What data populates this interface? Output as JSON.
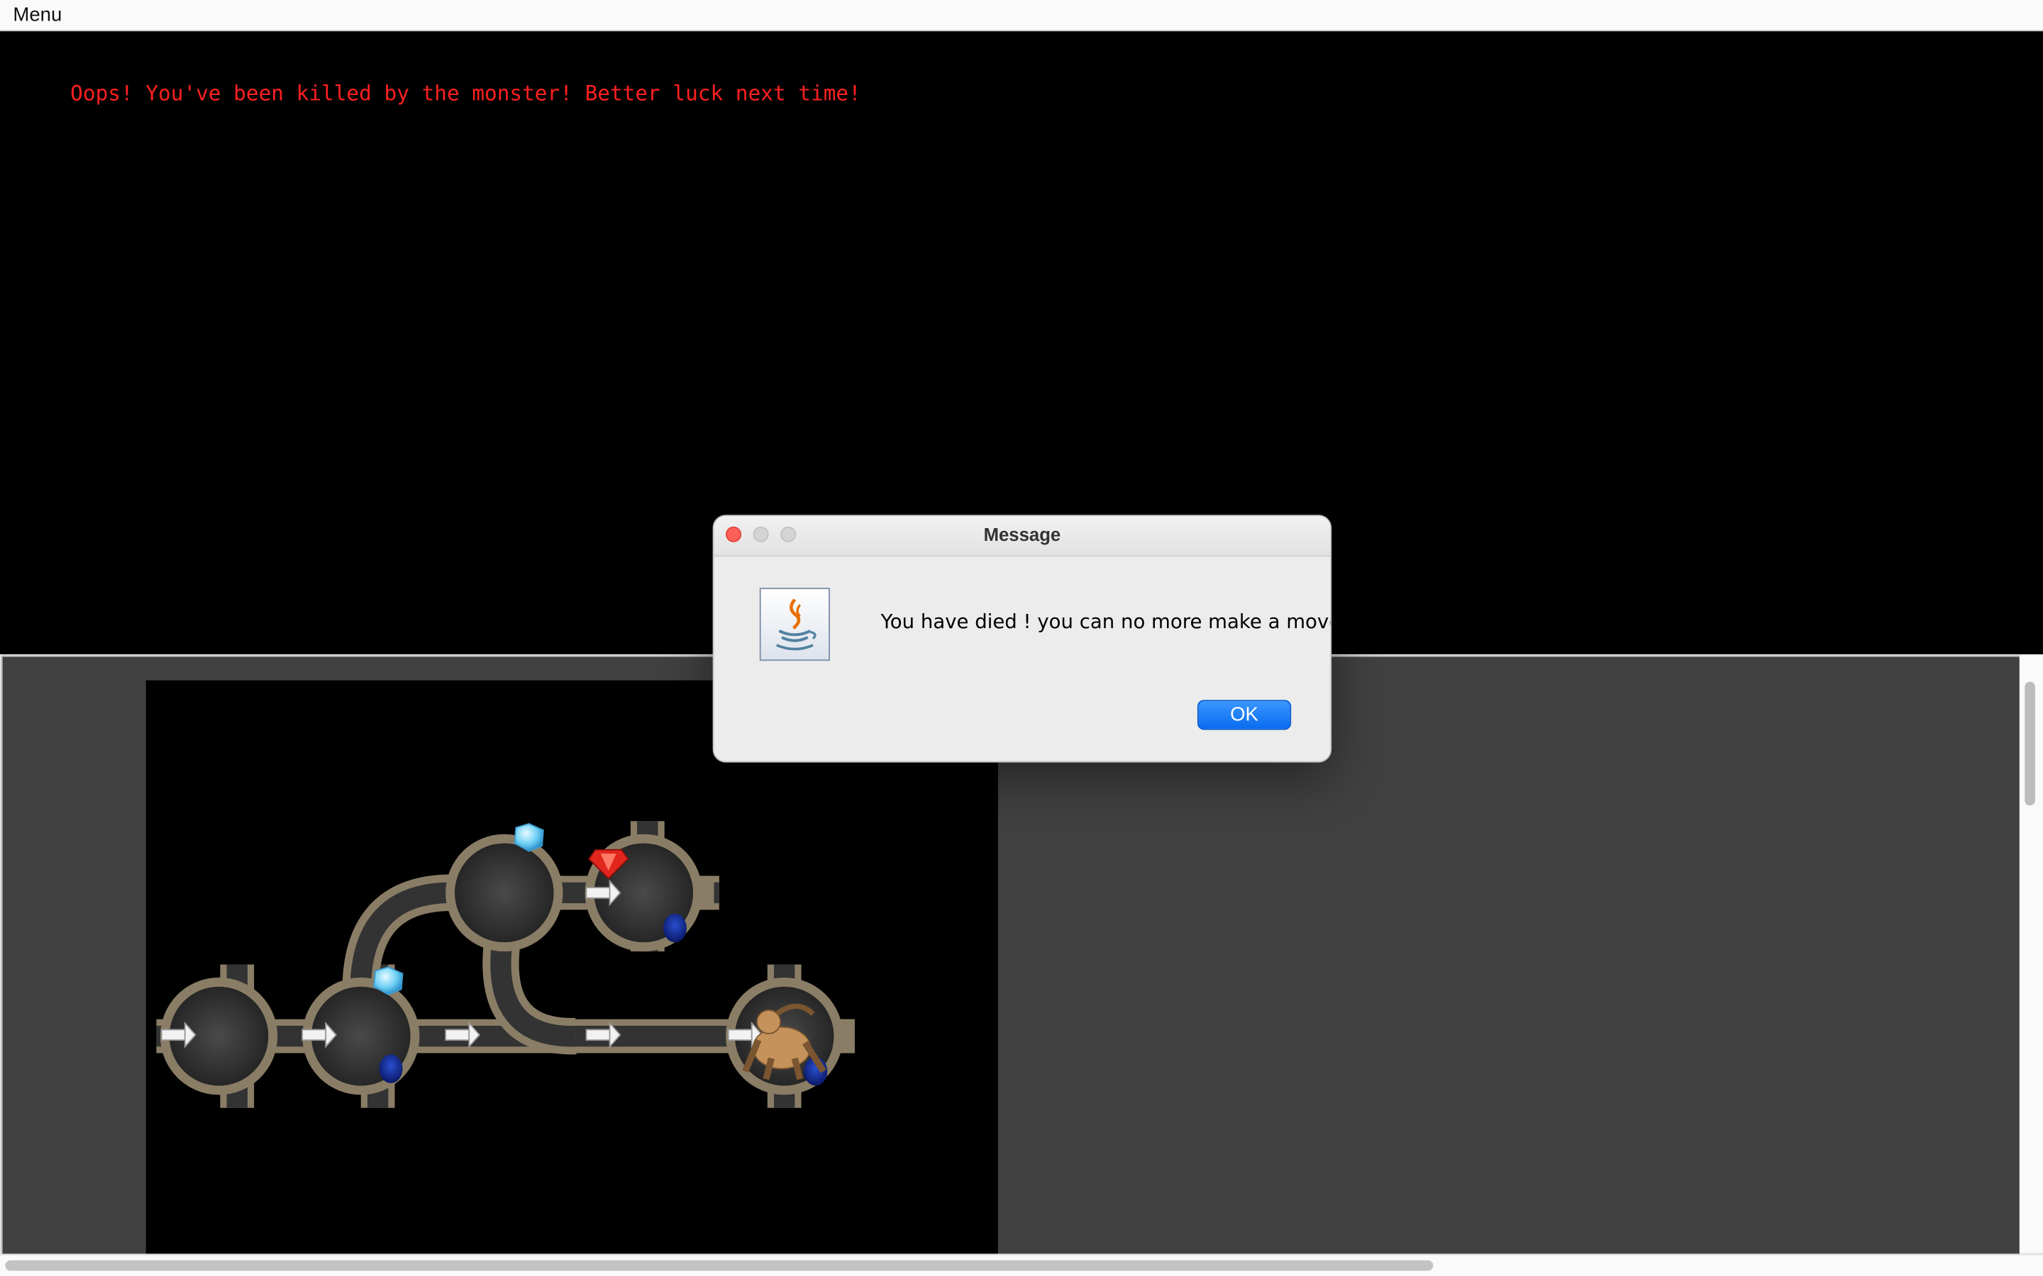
{
  "menubar": {
    "menu_label": "Menu"
  },
  "log": {
    "message": "Oops! You've been killed by the monster! Better luck next time!"
  },
  "dialog": {
    "title": "Message",
    "message": "You have died ! you can no more make a move!",
    "ok_label": "OK"
  },
  "colors": {
    "log_text": "#ff2020",
    "board_bg": "#000000",
    "viewport_bg": "#414141",
    "ok_button": "#0a6cf0"
  },
  "board": {
    "items": [
      "blue-gem",
      "blue-gem",
      "red-gem",
      "dark-pit",
      "dark-pit",
      "dark-pit",
      "dark-pit",
      "monster",
      "arrow"
    ]
  }
}
